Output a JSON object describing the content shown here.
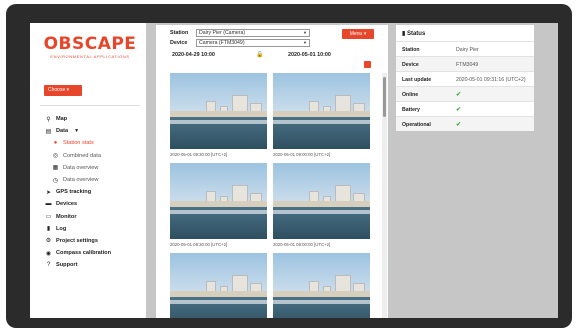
{
  "logo": {
    "name": "OBSCAPE",
    "tagline": "ENVIRONMENTAL APPLICATIONS"
  },
  "sidebar": {
    "choose_label": "Choose ▾",
    "items": [
      {
        "label": "Map",
        "icon": "map-marker-icon",
        "glyph": "⚲"
      },
      {
        "label": "Data",
        "icon": "chart-icon",
        "glyph": "▤",
        "caret": "▼"
      },
      {
        "label": "Station stats",
        "icon": "pin-icon",
        "glyph": "●",
        "sub": true,
        "active": true
      },
      {
        "label": "Combined data",
        "icon": "circle-icon",
        "glyph": "◎",
        "sub": true
      },
      {
        "label": "Data overview",
        "icon": "table-icon",
        "glyph": "▦",
        "sub": true
      },
      {
        "label": "Data overview",
        "icon": "clock-icon",
        "glyph": "◷",
        "sub": true
      },
      {
        "label": "GPS tracking",
        "icon": "location-arrow-icon",
        "glyph": "➤"
      },
      {
        "label": "Devices",
        "icon": "devices-icon",
        "glyph": "▬"
      },
      {
        "label": "Monitor",
        "icon": "monitor-icon",
        "glyph": "▭"
      },
      {
        "label": "Log",
        "icon": "book-icon",
        "glyph": "▮"
      },
      {
        "label": "Project settings",
        "icon": "gear-icon",
        "glyph": "⚙"
      },
      {
        "label": "Compass calibration",
        "icon": "compass-icon",
        "glyph": "◉"
      },
      {
        "label": "Support",
        "icon": "help-icon",
        "glyph": "?"
      }
    ]
  },
  "center": {
    "station_label": "Station",
    "station_value": "Dairy Pier (Camera)",
    "device_label": "Device",
    "device_value": "Camera (FTM3049)",
    "menu_label": "Menu ▾",
    "date_from": "2020-04-29 10:00",
    "date_to": "2020-05-01 10:00",
    "thumbnails": [
      {
        "caption": "2020-05-01 09:30:00 [UTC+2]"
      },
      {
        "caption": "2020-05-01 09:00:00 [UTC+2]"
      },
      {
        "caption": "2020-05-01 08:30:00 [UTC+2]"
      },
      {
        "caption": "2020-05-01 08:00:00 [UTC+2]"
      },
      {
        "caption": ""
      },
      {
        "caption": ""
      }
    ]
  },
  "status": {
    "title": "Status",
    "rows": [
      {
        "key": "Station",
        "value": "Dairy Pier"
      },
      {
        "key": "Device",
        "value": "FTM3049"
      },
      {
        "key": "Last update",
        "value": "2020-05-01 09:31:16 (UTC+2)"
      },
      {
        "key": "Online",
        "value": "✔"
      },
      {
        "key": "Battery",
        "value": "✔"
      },
      {
        "key": "Operational",
        "value": "✔"
      }
    ]
  },
  "colors": {
    "accent": "#e8462b",
    "ok": "#3aa83a"
  }
}
